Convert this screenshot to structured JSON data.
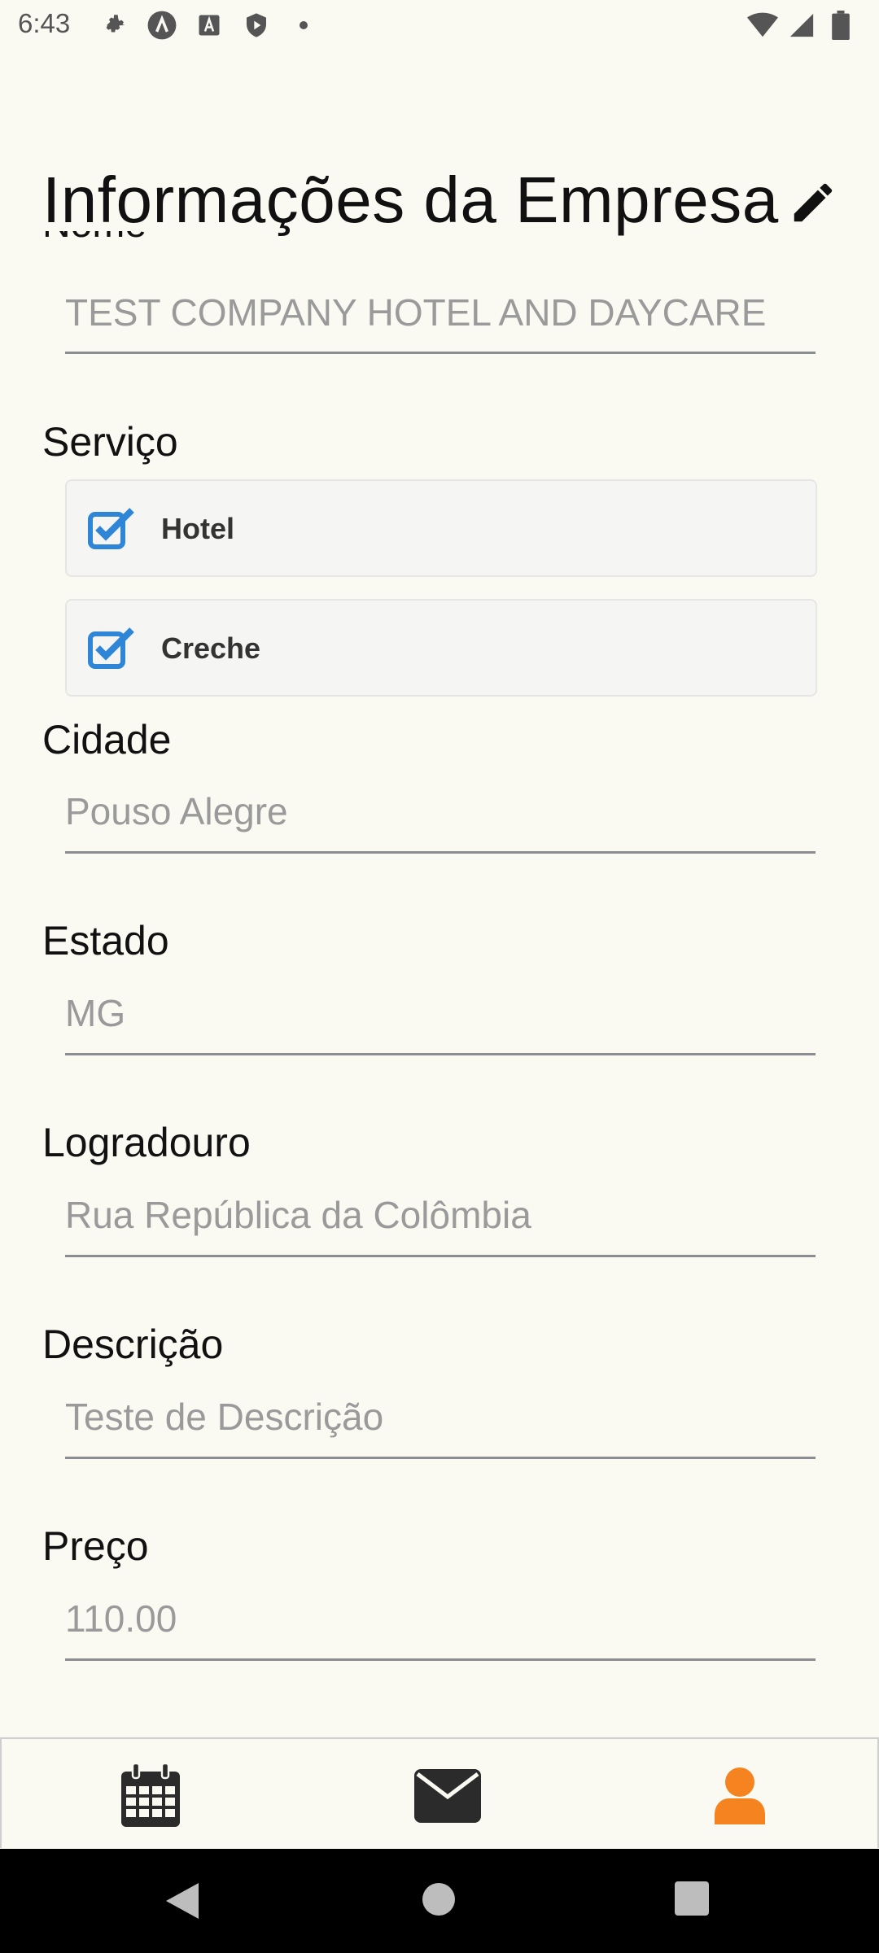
{
  "status_bar": {
    "time": "6:43",
    "left_icons": [
      "settings-icon",
      "a-circle-icon",
      "a-square-icon",
      "shield-icon",
      "dot-icon"
    ],
    "right_icons": [
      "wifi-icon",
      "signal-icon",
      "battery-icon"
    ]
  },
  "page": {
    "title": "Informações da Empresa",
    "edit_icon": "pencil-icon"
  },
  "form": {
    "nome": {
      "label": "Nome",
      "value": "TEST COMPANY HOTEL AND DAYCARE"
    },
    "servico": {
      "label": "Serviço",
      "options": [
        {
          "label": "Hotel",
          "checked": true
        },
        {
          "label": "Creche",
          "checked": true
        }
      ]
    },
    "cidade": {
      "label": "Cidade",
      "value": "Pouso Alegre"
    },
    "estado": {
      "label": "Estado",
      "value": "MG"
    },
    "logradouro": {
      "label": "Logradouro",
      "value": "Rua República da Colômbia"
    },
    "descricao": {
      "label": "Descrição",
      "value": "Teste de Descrição"
    },
    "preco": {
      "label": "Preço",
      "value": "110.00"
    }
  },
  "tab_bar": {
    "tabs": [
      {
        "icon": "calendar-icon",
        "active": false
      },
      {
        "icon": "envelope-icon",
        "active": false
      },
      {
        "icon": "user-icon",
        "active": true
      }
    ],
    "active_color": "#f5831f",
    "inactive_color": "#2b2b2b"
  },
  "nav_bar": {
    "buttons": [
      "back-icon",
      "home-icon",
      "recents-icon"
    ]
  },
  "colors": {
    "checkbox": "#2f86d6",
    "background": "#fbfaf2"
  }
}
